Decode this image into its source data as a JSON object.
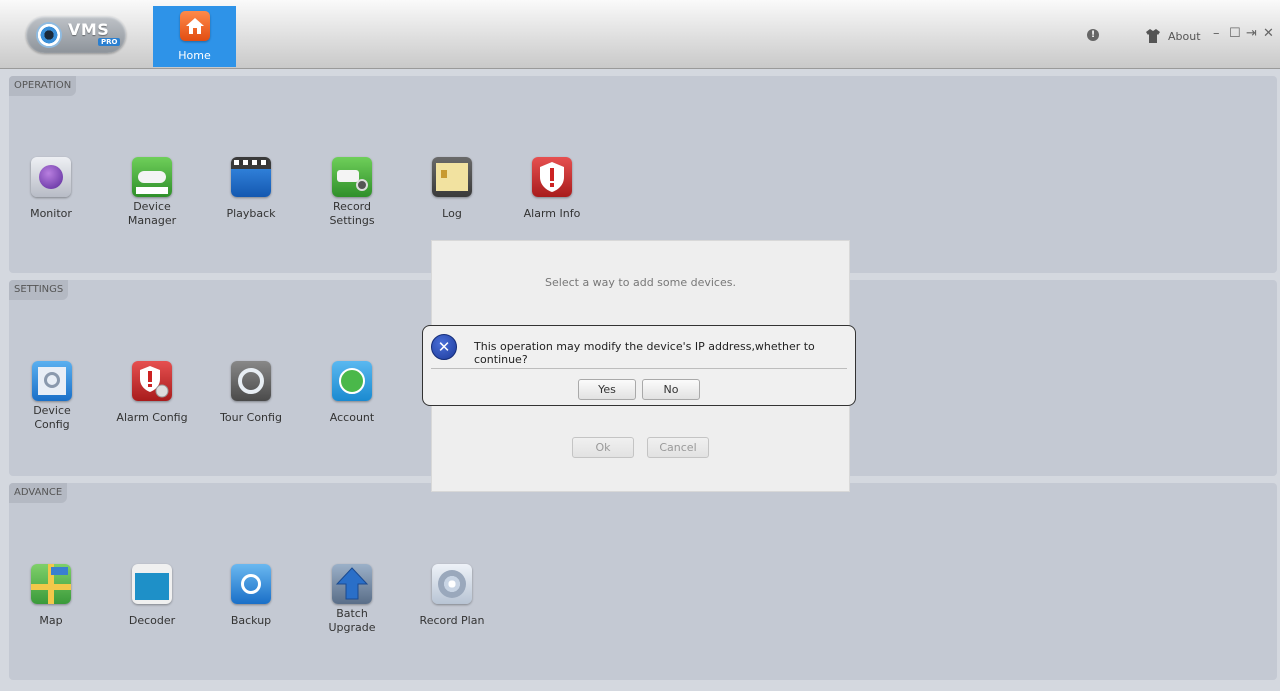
{
  "app": {
    "logo_text": "VMS",
    "logo_sub": "PRO",
    "home_tab": "Home",
    "about": "About",
    "window_controls": [
      "–",
      "☐",
      "⇥",
      "✕"
    ]
  },
  "sections": {
    "operation": {
      "title": "OPERATION",
      "tiles": [
        {
          "label": "Monitor",
          "icon": "monitor-icon"
        },
        {
          "label": "Device\nManager",
          "icon": "device-manager-icon"
        },
        {
          "label": "Playback",
          "icon": "playback-icon"
        },
        {
          "label": "Record\nSettings",
          "icon": "record-settings-icon"
        },
        {
          "label": "Log",
          "icon": "log-icon"
        },
        {
          "label": "Alarm Info",
          "icon": "alarm-info-icon"
        }
      ]
    },
    "settings": {
      "title": "SETTINGS",
      "tiles": [
        {
          "label": "Device\nConfig",
          "icon": "device-config-icon"
        },
        {
          "label": "Alarm Config",
          "icon": "alarm-config-icon"
        },
        {
          "label": "Tour Config",
          "icon": "tour-config-icon"
        },
        {
          "label": "Account",
          "icon": "account-icon"
        }
      ]
    },
    "advance": {
      "title": "ADVANCE",
      "tiles": [
        {
          "label": "Map",
          "icon": "map-icon"
        },
        {
          "label": "Decoder",
          "icon": "decoder-icon"
        },
        {
          "label": "Backup",
          "icon": "backup-icon"
        },
        {
          "label": "Batch\nUpgrade",
          "icon": "batch-upgrade-icon"
        },
        {
          "label": "Record Plan",
          "icon": "record-plan-icon"
        }
      ]
    }
  },
  "add_dialog": {
    "message": "Select a way to add some devices.",
    "ok": "Ok",
    "cancel": "Cancel"
  },
  "confirm_dialog": {
    "message": "This operation may modify the device's IP address,whether to continue?",
    "yes": "Yes",
    "no": "No"
  }
}
